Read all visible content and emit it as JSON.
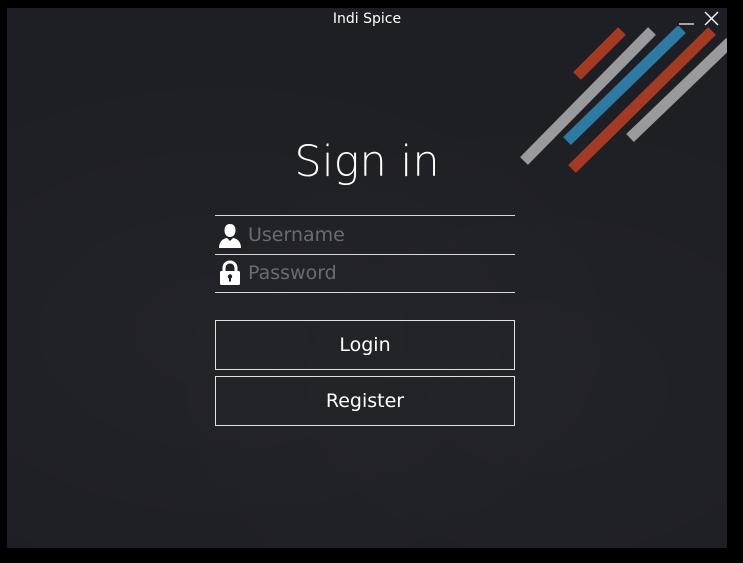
{
  "window": {
    "title": "Indi Spice",
    "minimize_icon": "minimize-icon",
    "close_icon": "close-icon"
  },
  "form": {
    "heading": "Sign in",
    "username": {
      "placeholder": "Username",
      "value": "",
      "icon": "user-icon"
    },
    "password": {
      "placeholder": "Password",
      "value": "",
      "icon": "lock-icon"
    },
    "login_label": "Login",
    "register_label": "Register"
  },
  "colors": {
    "background": "#1e1f25",
    "text": "#ffffff",
    "placeholder": "#6a6c72",
    "stripe_gray": "#9a9a9c",
    "stripe_blue": "#2e7aa3",
    "stripe_red": "#a33a24"
  }
}
